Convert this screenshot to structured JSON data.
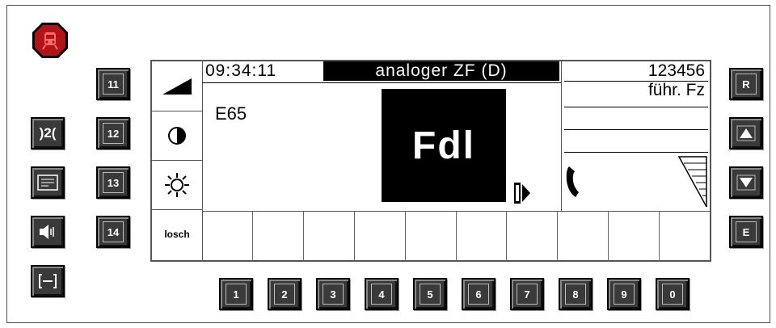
{
  "alarm": {
    "icon": "train-alarm-icon",
    "color": "#c0151a"
  },
  "left_buttons": [
    {
      "name": "pantograph-icon"
    },
    {
      "name": "message-icon"
    },
    {
      "name": "speaker-icon"
    },
    {
      "name": "coupling-icon"
    }
  ],
  "function_keys": [
    "11",
    "12",
    "13",
    "14"
  ],
  "screen": {
    "left_controls": [
      {
        "name": "volume-ramp-icon"
      },
      {
        "name": "contrast-icon"
      },
      {
        "name": "brightness-icon"
      },
      {
        "name": "loesch-button",
        "label": "losch"
      }
    ],
    "time": "09:34:11",
    "mode": "analoger ZF (D)",
    "train_number": "E65",
    "role": "Fdl",
    "id_number": "123456",
    "role_right": "führ. Fz",
    "soft_keys": [
      "",
      "",
      "",
      "",
      "",
      "",
      "",
      "",
      "",
      "",
      ""
    ]
  },
  "right_keys": {
    "reset": "R",
    "up_icon": "arrow-up-icon",
    "down_icon": "arrow-down-icon",
    "enter": "E"
  },
  "numeric_keys": [
    "1",
    "2",
    "3",
    "4",
    "5",
    "6",
    "7",
    "8",
    "9",
    "0"
  ]
}
